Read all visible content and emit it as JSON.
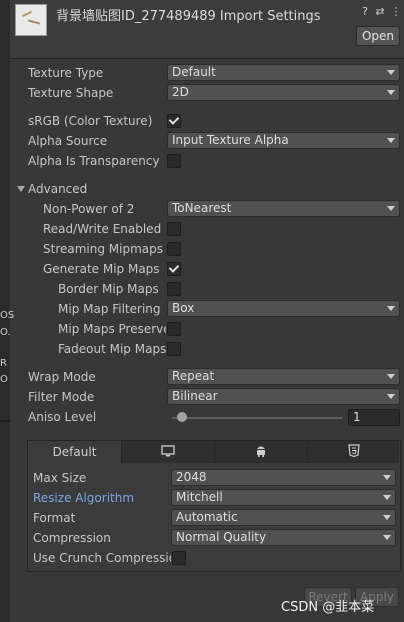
{
  "left_strip": {
    "fragments": [
      "OS",
      "O.",
      "R",
      "O"
    ]
  },
  "header": {
    "title": "背景墙贴图ID_277489489 Import Settings",
    "icons": [
      "help-icon",
      "preset-icon",
      "overflow-menu-icon"
    ],
    "open_label": "Open"
  },
  "rows": {
    "texture_type": {
      "label": "Texture Type",
      "value": "Default"
    },
    "texture_shape": {
      "label": "Texture Shape",
      "value": "2D"
    },
    "srgb": {
      "label": "sRGB (Color Texture)",
      "checked": true
    },
    "alpha_source": {
      "label": "Alpha Source",
      "value": "Input Texture Alpha"
    },
    "alpha_transparency": {
      "label": "Alpha Is Transparency",
      "checked": false
    },
    "advanced": {
      "label": "Advanced",
      "expanded": true
    },
    "npot": {
      "label": "Non-Power of 2",
      "value": "ToNearest"
    },
    "read_write": {
      "label": "Read/Write Enabled",
      "checked": false
    },
    "streaming": {
      "label": "Streaming Mipmaps",
      "checked": false
    },
    "gen_mips": {
      "label": "Generate Mip Maps",
      "checked": true
    },
    "border_mips": {
      "label": "Border Mip Maps",
      "checked": false
    },
    "mip_filter": {
      "label": "Mip Map Filtering",
      "value": "Box"
    },
    "mip_preserve": {
      "label": "Mip Maps Preserve",
      "checked": false
    },
    "fadeout": {
      "label": "Fadeout Mip Maps",
      "checked": false
    },
    "wrap_mode": {
      "label": "Wrap Mode",
      "value": "Repeat"
    },
    "filter_mode": {
      "label": "Filter Mode",
      "value": "Bilinear"
    },
    "aniso": {
      "label": "Aniso Level",
      "value": "1",
      "fraction": 0.06
    }
  },
  "platform": {
    "tabs": [
      "Default",
      "standalone-monitor-icon",
      "android-icon",
      "html5-icon"
    ],
    "active_tab": "Default",
    "max_size": {
      "label": "Max Size",
      "value": "2048"
    },
    "resize": {
      "label": "Resize Algorithm",
      "value": "Mitchell"
    },
    "format": {
      "label": "Format",
      "value": "Automatic"
    },
    "compression": {
      "label": "Compression",
      "value": "Normal Quality"
    },
    "crunch": {
      "label": "Use Crunch Compression",
      "checked": false
    }
  },
  "footer": {
    "revert_label": "Revert",
    "apply_label": "Apply"
  },
  "watermark": "CSDN @韭本菜",
  "colors": {
    "background": "#383838",
    "blue_label": "#7aa5e6"
  }
}
